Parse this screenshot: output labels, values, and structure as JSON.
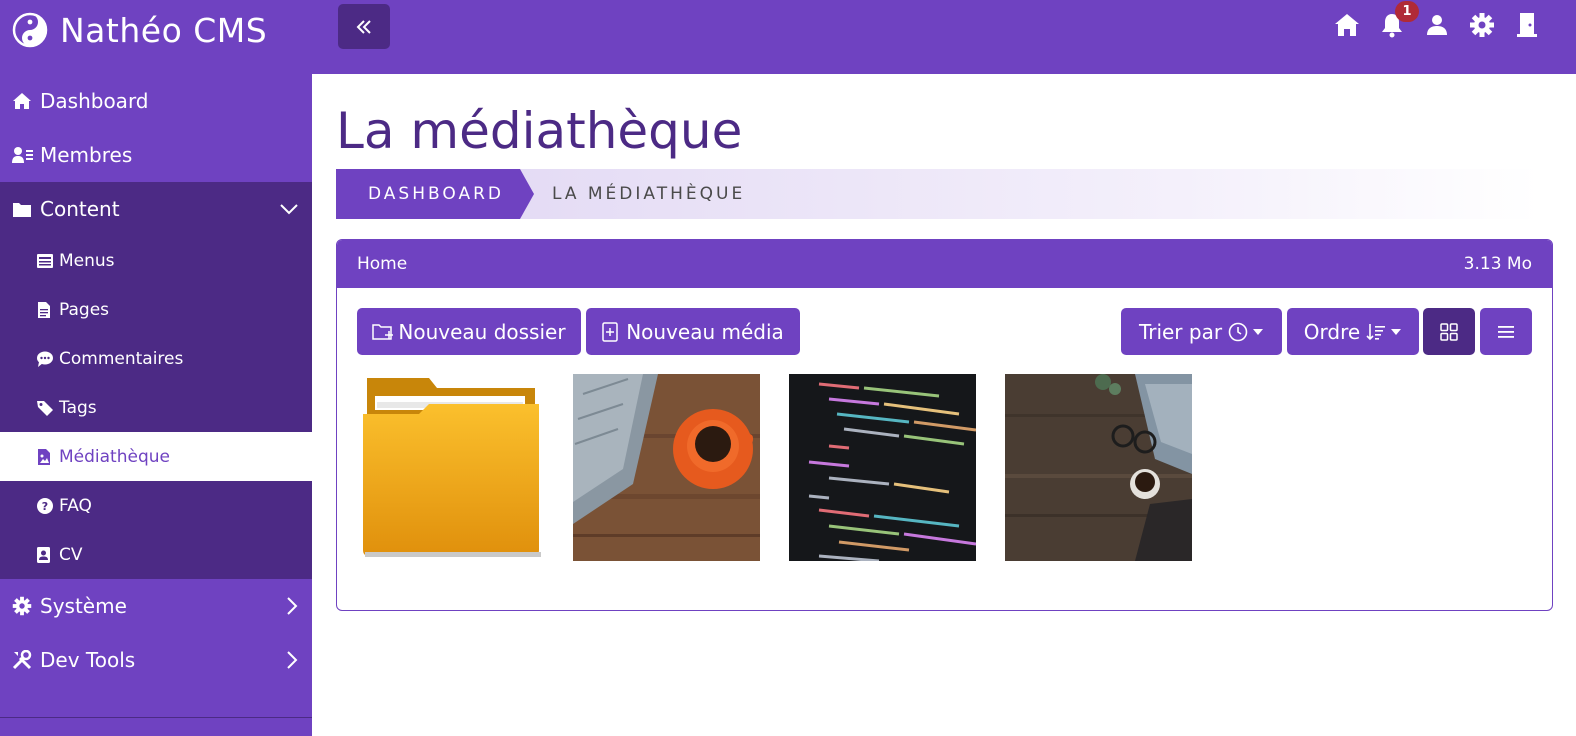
{
  "app": {
    "brand": "Nathéo CMS",
    "notification_count": "1",
    "colors": {
      "primary": "#6f42c1",
      "primary_dark": "#4c2a85",
      "badge": "#b02a37"
    },
    "top_icons": [
      "home-icon",
      "bell-icon",
      "user-icon",
      "gear-icon",
      "door-icon"
    ]
  },
  "sidebar": {
    "dashboard": "Dashboard",
    "membres": "Membres",
    "content": "Content",
    "sub_items": {
      "menus": "Menus",
      "pages": "Pages",
      "commentaires": "Commentaires",
      "tags": "Tags",
      "mediatheque": "Médiathèque",
      "faq": "FAQ",
      "cv": "CV"
    },
    "systeme": "Système",
    "dev_tools": "Dev Tools"
  },
  "main": {
    "title": "La médiathèque",
    "breadcrumb": [
      "DASHBOARD",
      "LA MÉDIATHÈQUE"
    ],
    "card": {
      "folder_name": "Home",
      "size": "3.13 Mo"
    },
    "toolbar": {
      "new_folder": "Nouveau dossier",
      "new_media": "Nouveau média",
      "sort_by": "Trier par",
      "order": "Ordre"
    },
    "media": [
      {
        "kind": "folder"
      },
      {
        "kind": "image",
        "subject": "laptop and coffee cup on wooden desk"
      },
      {
        "kind": "image",
        "subject": "source code on dark screen"
      },
      {
        "kind": "image",
        "subject": "desk with glasses, coffee and laptop"
      }
    ]
  }
}
